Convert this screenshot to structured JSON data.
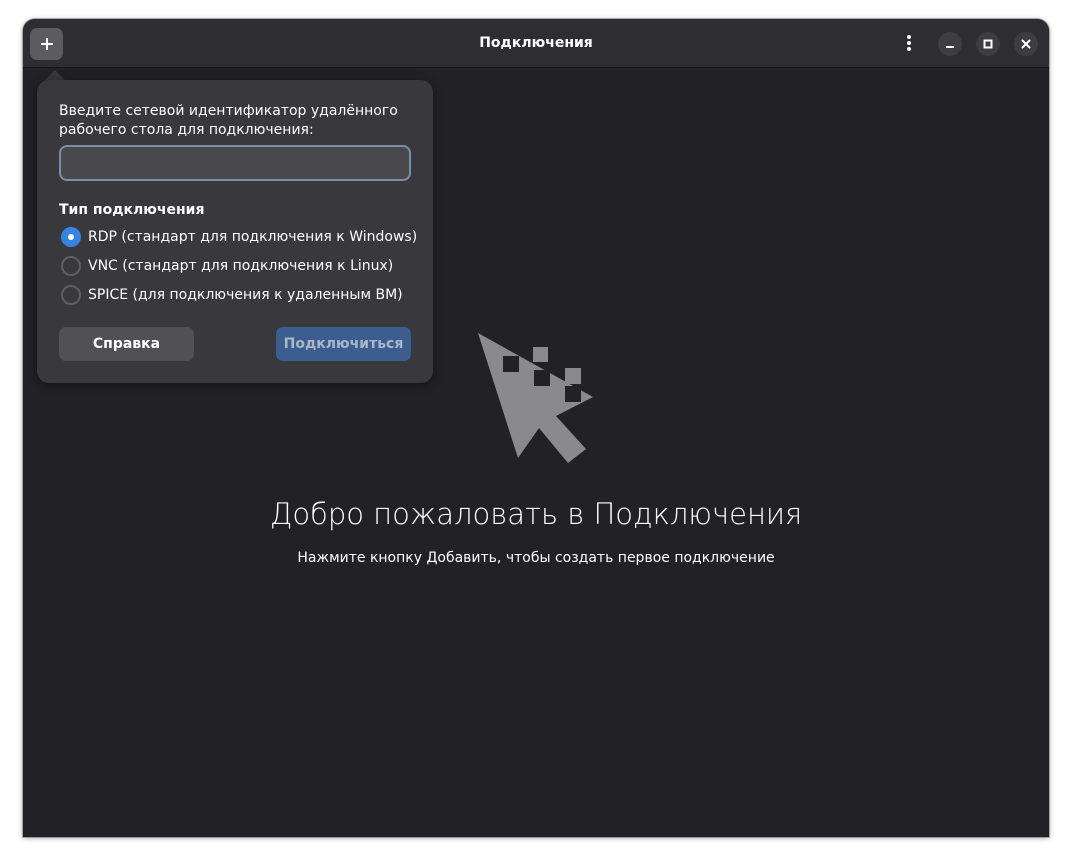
{
  "window": {
    "title": "Подключения"
  },
  "header": {
    "add_icon": "plus-icon",
    "menu_icon": "vertical-dots-icon",
    "controls": [
      "minimize-icon",
      "maximize-icon",
      "close-icon"
    ]
  },
  "empty_state": {
    "icon": "remote-desktop-cursor-icon",
    "title": "Добро пожаловать в Подключения",
    "subtitle": "Нажмите кнопку Добавить, чтобы создать первое подключение"
  },
  "popover": {
    "prompt": "Введите сетевой идентификатор удалённого рабочего стола для подключения:",
    "input_value": "",
    "section_title": "Тип подключения",
    "options": [
      {
        "label": "RDP (стандарт для подключения к Windows)",
        "checked": true
      },
      {
        "label": "VNC (стандарт для подключения к Linux)",
        "checked": false
      },
      {
        "label": "SPICE (для подключения к удаленным ВМ)",
        "checked": false
      }
    ],
    "help_label": "Справка",
    "connect_label": "Подключиться"
  },
  "colors": {
    "window_bg": "#222226",
    "headerbar_bg": "#2e2e32",
    "popover_bg": "#38383d",
    "accent": "#3584e4",
    "connect_disabled_bg": "#3c5e8e"
  }
}
